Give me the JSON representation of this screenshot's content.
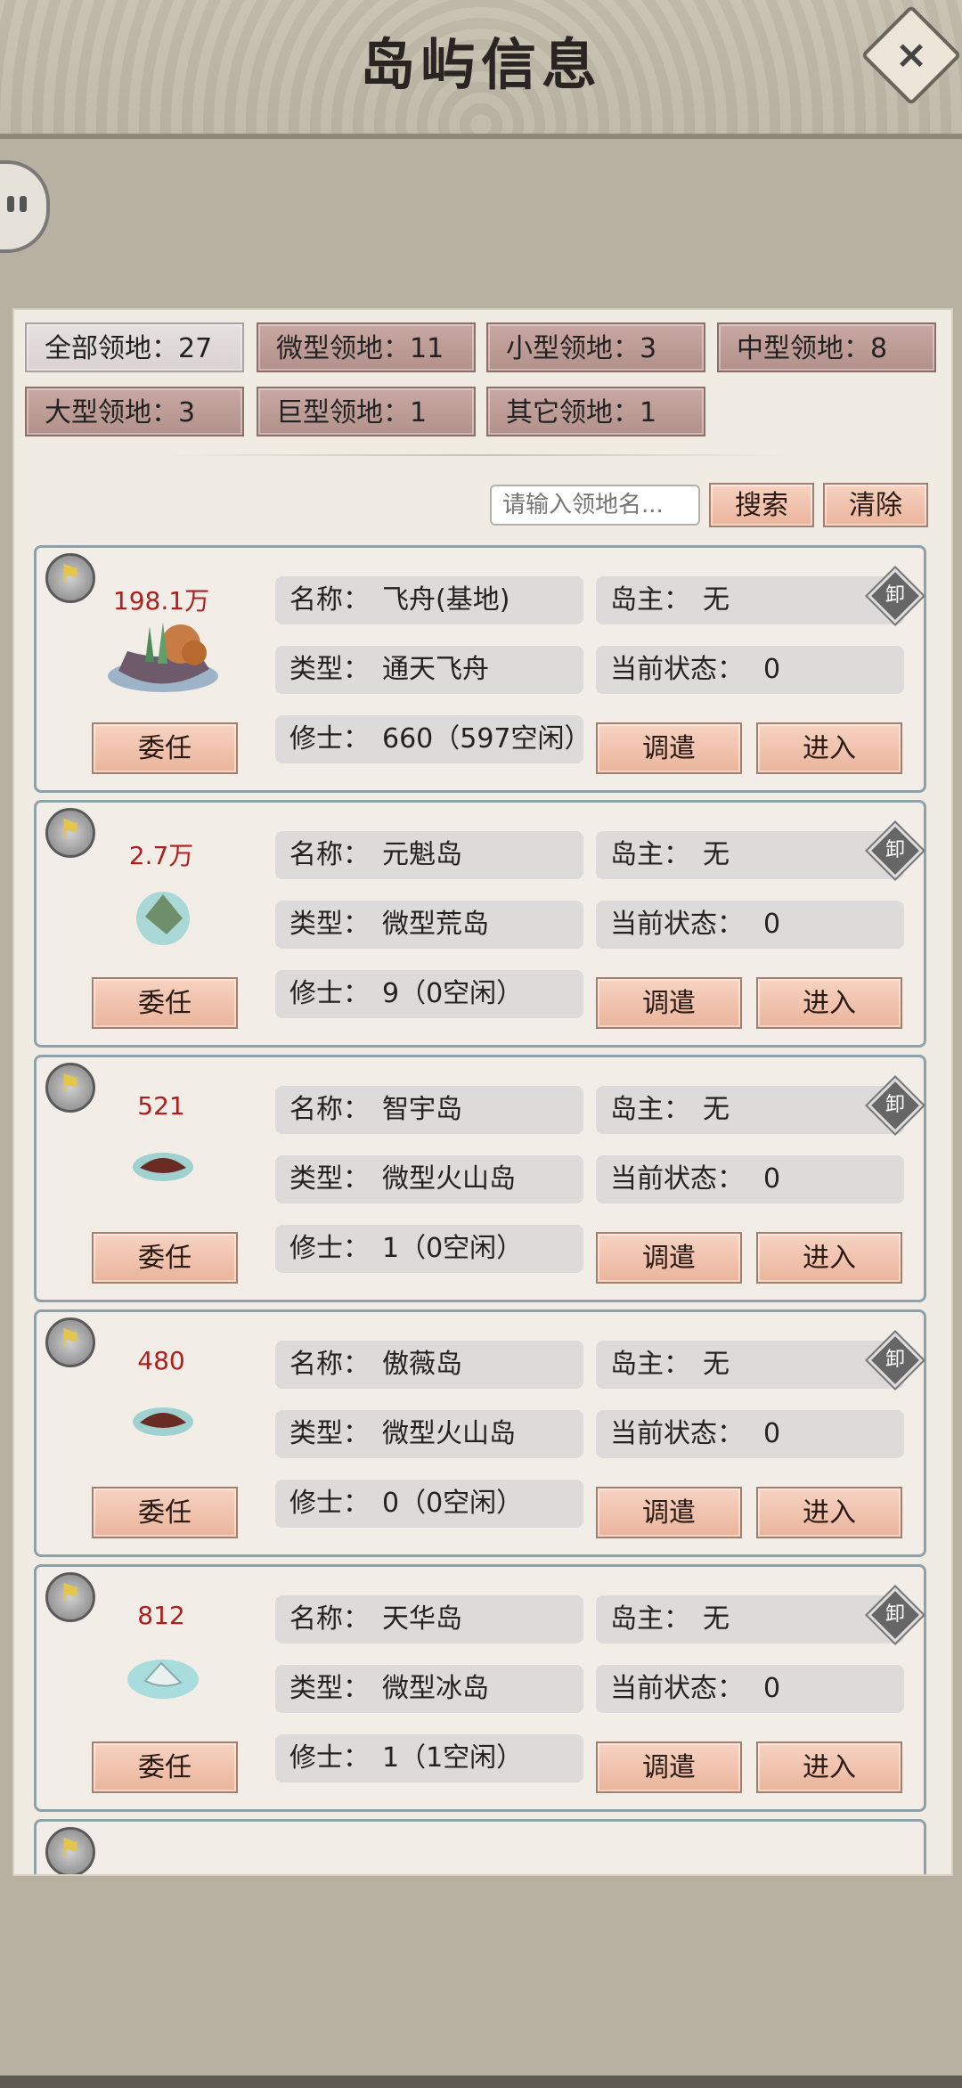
{
  "header": {
    "title": "岛屿信息",
    "close_label": "×"
  },
  "filters": [
    {
      "label": "全部领地：27"
    },
    {
      "label": "微型领地：11"
    },
    {
      "label": "小型领地：3"
    },
    {
      "label": "中型领地：8"
    },
    {
      "label": "大型领地：3"
    },
    {
      "label": "巨型领地：1"
    },
    {
      "label": "其它领地：1"
    }
  ],
  "search": {
    "placeholder": "请输入领地名...",
    "search_label": "搜索",
    "clear_label": "清除"
  },
  "labels": {
    "name": "名称：",
    "type": "类型：",
    "cultivator": "修士：",
    "owner": "岛主：",
    "status": "当前状态：",
    "appoint": "委任",
    "dispatch": "调遣",
    "enter": "进入",
    "unload": "卸"
  },
  "islands": [
    {
      "power": "198.1万",
      "name": "飞舟(基地)",
      "type": "通天飞舟",
      "cultivators": "660（597空闲）",
      "owner": "无",
      "status": "0"
    },
    {
      "power": "2.7万",
      "name": "元魁岛",
      "type": "微型荒岛",
      "cultivators": "9（0空闲）",
      "owner": "无",
      "status": "0"
    },
    {
      "power": "521",
      "name": "智宇岛",
      "type": "微型火山岛",
      "cultivators": "1（0空闲）",
      "owner": "无",
      "status": "0"
    },
    {
      "power": "480",
      "name": "傲薇岛",
      "type": "微型火山岛",
      "cultivators": "0（0空闲）",
      "owner": "无",
      "status": "0"
    },
    {
      "power": "812",
      "name": "天华岛",
      "type": "微型冰岛",
      "cultivators": "1（1空闲）",
      "owner": "无",
      "status": "0"
    }
  ],
  "colors": {
    "accent": "#eab49b",
    "power": "#b01d1d",
    "card_border": "#8ea2ac"
  }
}
